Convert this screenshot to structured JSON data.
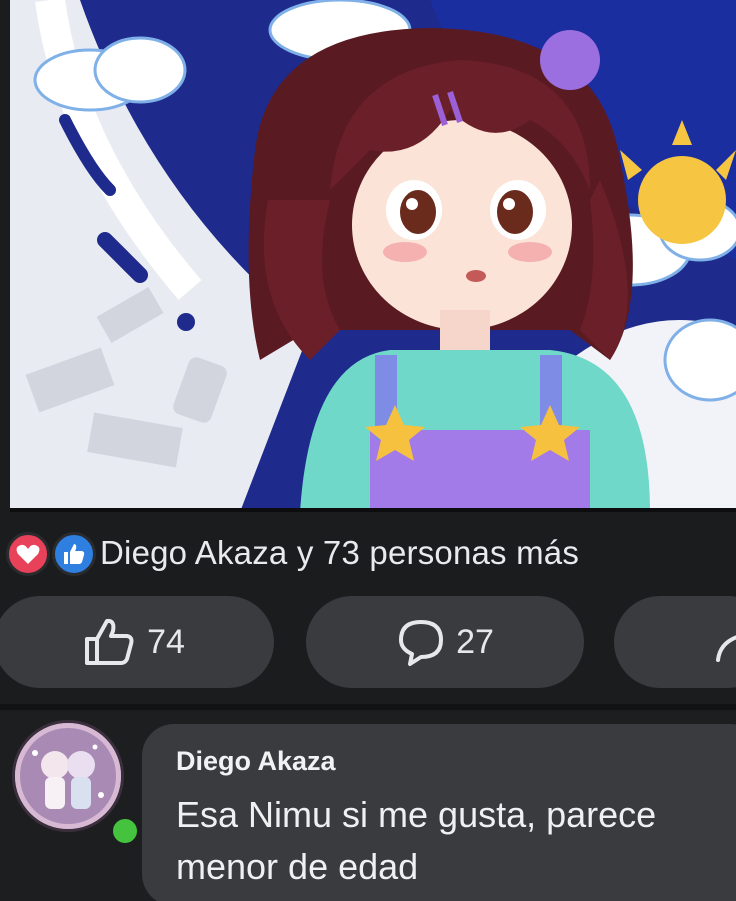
{
  "post": {
    "image_description_icon": "anime-girl-illustration"
  },
  "reactions": {
    "icons": [
      "heart-reaction-icon",
      "thumbs-up-reaction-icon"
    ],
    "summary": "Diego Akaza y 73 personas más"
  },
  "actions": {
    "like_count": "74",
    "comment_count": "27"
  },
  "comment": {
    "author": "Diego Akaza",
    "text": "Esa Nimu si me gusta, parece\nmenor de edad",
    "online": true
  },
  "colors": {
    "love": "#e8415a",
    "like": "#2f7fe0",
    "online": "#45c23e",
    "bubble": "#3a3b3e"
  }
}
